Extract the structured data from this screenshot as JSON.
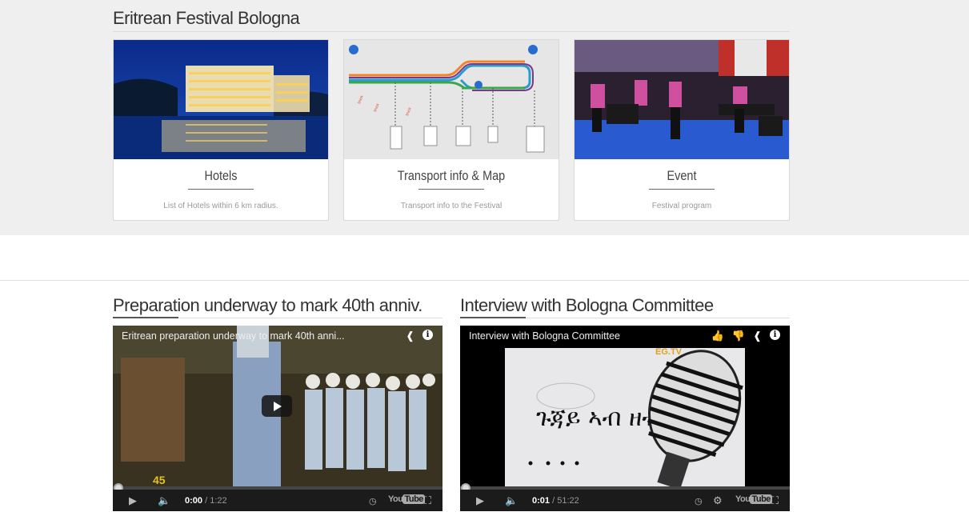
{
  "festival": {
    "title": "Eritrean Festival Bologna",
    "cards": [
      {
        "title": "Hotels",
        "desc": "List of Hotels within 6 km radius."
      },
      {
        "title": "Transport info & Map",
        "desc": "Transport info to the Festival"
      },
      {
        "title": "Event",
        "desc": "Festival program"
      }
    ]
  },
  "videos": [
    {
      "section_title": "Preparation underway to mark 40th anniv.",
      "title": "Eritrean preparation underway to mark 40th anni...",
      "time_current": "0:00",
      "time_total": "/ 1:22",
      "progress": 0
    },
    {
      "section_title": "Interview with Bologna Committee",
      "title": "Interview with Bologna Committee",
      "time_current": "0:01",
      "time_total": "/ 51:22",
      "progress": 0.0003
    }
  ],
  "youtube_label": {
    "you": "You",
    "tube": "Tube"
  }
}
